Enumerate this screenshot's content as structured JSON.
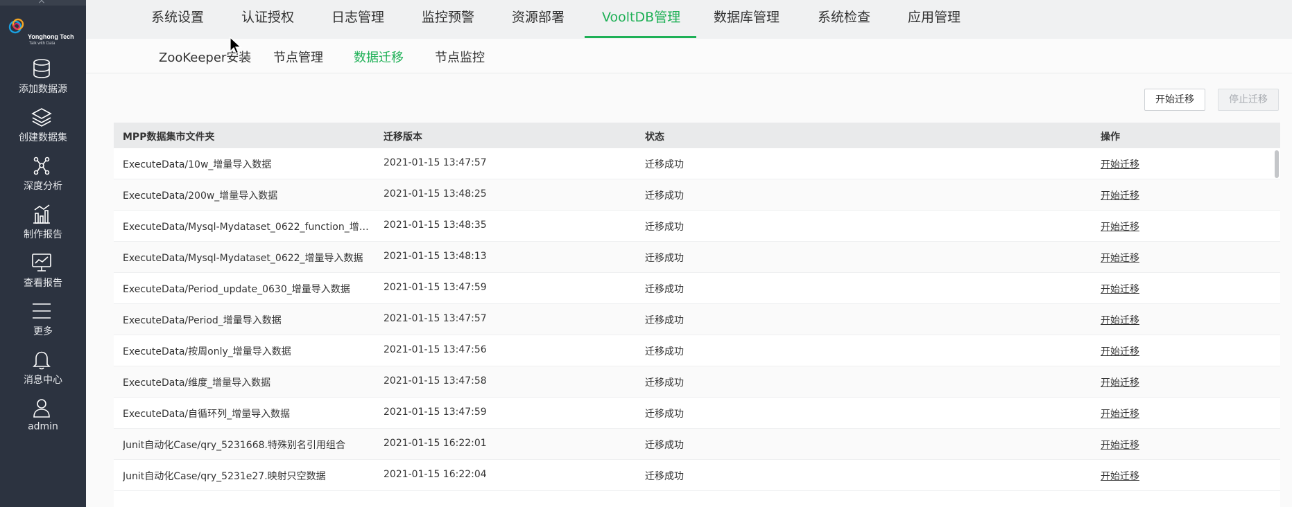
{
  "sidebar": {
    "close_glyph": "×",
    "logo": {
      "brand": "Yonghong Tech",
      "tagline": "Talk with Data"
    },
    "items": [
      {
        "label": "添加数据源",
        "icon": "database-icon"
      },
      {
        "label": "创建数据集",
        "icon": "layers-icon"
      },
      {
        "label": "深度分析",
        "icon": "network-icon"
      },
      {
        "label": "制作报告",
        "icon": "bar-chart-icon"
      },
      {
        "label": "查看报告",
        "icon": "monitor-chart-icon"
      },
      {
        "label": "更多",
        "icon": "menu-icon"
      },
      {
        "label": "消息中心",
        "icon": "bell-icon"
      },
      {
        "label": "admin",
        "icon": "user-icon"
      }
    ]
  },
  "topnav": {
    "tabs": [
      {
        "label": "系统设置"
      },
      {
        "label": "认证授权"
      },
      {
        "label": "日志管理"
      },
      {
        "label": "监控预警"
      },
      {
        "label": "资源部署"
      },
      {
        "label": "VooltDB管理",
        "active": true
      },
      {
        "label": "数据库管理"
      },
      {
        "label": "系统检查"
      },
      {
        "label": "应用管理"
      }
    ]
  },
  "subnav": {
    "tabs": [
      {
        "label": "ZooKeeper安装"
      },
      {
        "label": "节点管理"
      },
      {
        "label": "数据迁移",
        "active": true
      },
      {
        "label": "节点监控"
      }
    ]
  },
  "toolbar": {
    "start_label": "开始迁移",
    "stop_label": "停止迁移"
  },
  "table": {
    "columns": [
      "MPP数据集市文件夹",
      "迁移版本",
      "状态",
      "操作"
    ],
    "rows": [
      {
        "folder": "ExecuteData/10w_增量导入数据",
        "version": "2021-01-15 13:47:57",
        "status": "迁移成功",
        "action": "开始迁移"
      },
      {
        "folder": "ExecuteData/200w_增量导入数据",
        "version": "2021-01-15 13:48:25",
        "status": "迁移成功",
        "action": "开始迁移"
      },
      {
        "folder": "ExecuteData/Mysql-Mydataset_0622_function_增量...",
        "version": "2021-01-15 13:48:35",
        "status": "迁移成功",
        "action": "开始迁移"
      },
      {
        "folder": "ExecuteData/Mysql-Mydataset_0622_增量导入数据",
        "version": "2021-01-15 13:48:13",
        "status": "迁移成功",
        "action": "开始迁移"
      },
      {
        "folder": "ExecuteData/Period_update_0630_增量导入数据",
        "version": "2021-01-15 13:47:59",
        "status": "迁移成功",
        "action": "开始迁移"
      },
      {
        "folder": "ExecuteData/Period_增量导入数据",
        "version": "2021-01-15 13:47:57",
        "status": "迁移成功",
        "action": "开始迁移"
      },
      {
        "folder": "ExecuteData/按周only_增量导入数据",
        "version": "2021-01-15 13:47:56",
        "status": "迁移成功",
        "action": "开始迁移"
      },
      {
        "folder": "ExecuteData/维度_增量导入数据",
        "version": "2021-01-15 13:47:58",
        "status": "迁移成功",
        "action": "开始迁移"
      },
      {
        "folder": "ExecuteData/自循环列_增量导入数据",
        "version": "2021-01-15 13:47:59",
        "status": "迁移成功",
        "action": "开始迁移"
      },
      {
        "folder": "Junit自动化Case/qry_5231668.特殊别名引用组合",
        "version": "2021-01-15 16:22:01",
        "status": "迁移成功",
        "action": "开始迁移"
      },
      {
        "folder": "Junit自动化Case/qry_5231e27.映射只空数据",
        "version": "2021-01-15 16:22:04",
        "status": "迁移成功",
        "action": "开始迁移"
      }
    ]
  },
  "colors": {
    "sidebar_bg": "#2c3340",
    "accent": "#1eb056",
    "header_bg": "#e9eaeb"
  }
}
